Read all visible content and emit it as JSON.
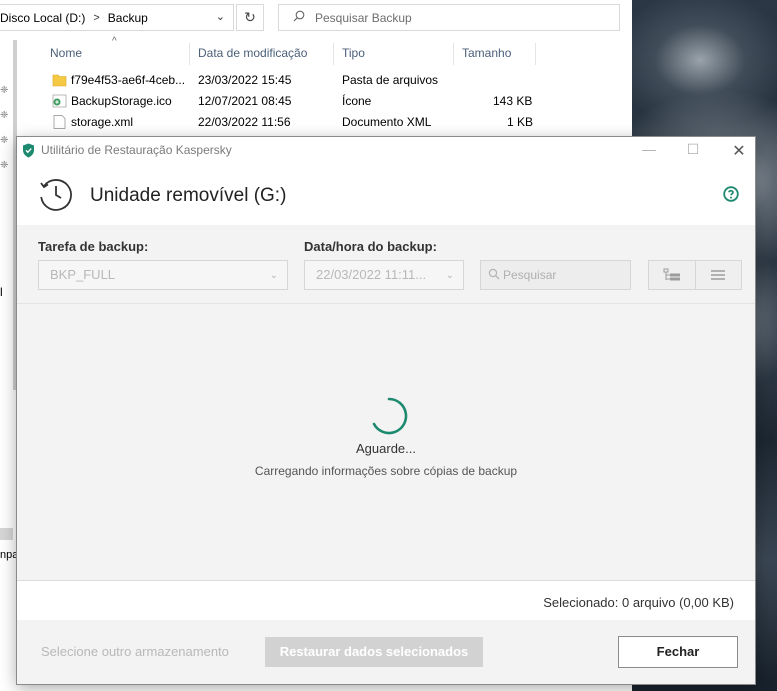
{
  "explorer": {
    "breadcrumb": [
      "Disco Local (D:)",
      "Backup"
    ],
    "search_placeholder": "Pesquisar Backup",
    "columns": [
      "Nome",
      "Data de modificação",
      "Tipo",
      "Tamanho"
    ],
    "files": [
      {
        "name": "f79e4f53-ae6f-4ceb...",
        "date": "23/03/2022 15:45",
        "type": "Pasta de arquivos",
        "size": "",
        "icon": "folder-icon"
      },
      {
        "name": "BackupStorage.ico",
        "date": "12/07/2021 08:45",
        "type": "Ícone",
        "size": "143 KB",
        "icon": "ico-file-icon"
      },
      {
        "name": "storage.xml",
        "date": "22/03/2022 11:56",
        "type": "Documento XML",
        "size": "1 KB",
        "icon": "xml-file-icon"
      }
    ],
    "edge_fragment_1": "l",
    "edge_fragment_2": "npa"
  },
  "dialog": {
    "window_title": "Utilitário de Restauração Kaspersky",
    "device_title": "Unidade removível (G:)",
    "backup_task_label": "Tarefa de backup:",
    "backup_task_value": "BKP_FULL",
    "backup_datetime_label": "Data/hora do backup:",
    "backup_datetime_value": "22/03/2022 11:11...",
    "search_placeholder": "Pesquisar",
    "wait_text": "Aguarde...",
    "loading_text": "Carregando informações sobre cópias de backup",
    "selected_text": "Selecionado: 0 arquivo (0,00 KB)",
    "other_storage_label": "Selecione outro armazenamento",
    "restore_button_label": "Restaurar dados selecionados",
    "close_button_label": "Fechar",
    "accent_color": "#1d8a6f"
  }
}
